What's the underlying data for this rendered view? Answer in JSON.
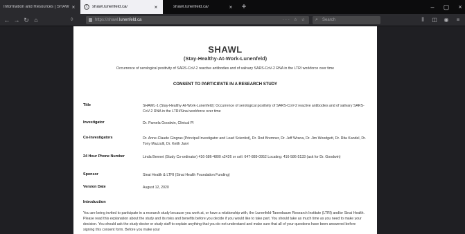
{
  "tabs": [
    {
      "title": "Information and Resources | SHAW"
    },
    {
      "title": "shawl.lunenfeld.ca/"
    },
    {
      "title": "shawl.lunenfeld.ca/"
    }
  ],
  "address_bar": {
    "prefix": "https://shawl.",
    "domain": "lunenfeld.ca",
    "actions": "··· ☆ ☆"
  },
  "search": {
    "placeholder": "Search"
  },
  "page": {
    "brand": "SHAWL",
    "brand_sub": "(Stay-Healthy-At-Work-Lunenfeld)",
    "study_line": "Occurrence of serological positivity of SARS-CoV-2 reactive antibodies and of salivary SARS-CoV-2 RNA in the LTRI workforce over time",
    "consent_heading": "CONSENT TO PARTICIPATE IN A RESEARCH STUDY",
    "rows": [
      {
        "label": "Title",
        "value": "SHAWL-1 (Stay-Healthy-At-Work-Lunenfeld): Occurrence of serological positivity of SARS-CoV-2 reactive antibodies and of salivary SARS-CoV-2 RNA in the LTRI/Sinai workforce over time"
      },
      {
        "label": "Investigator",
        "value": "Dr. Pamela Goodwin, Clinical PI"
      },
      {
        "label": "Co-Investigators",
        "value": "Dr. Anne-Claude Gingras (Principal Investigator and Lead Scientist), Dr. Rod Bremner, Dr. Jeff Wrana, Dr. Jim Woodgett, Dr. Rita Kandel, Dr. Tony Mazzulli, Dr. Keith Jarvi"
      },
      {
        "label": "24 Hour Phone Number",
        "value": "Linda Bennet (Study Co-ordinator) 416-586-4800 x2426 or cell: 647-889-0952 Locating: 416-586-5133 (ask for Dr. Goodwin)"
      },
      {
        "label": "Sponsor",
        "value": "Sinai Health & LTRI (Sinai Health Foundation Funding)"
      },
      {
        "label": "Version Date",
        "value": "August 12, 2020"
      }
    ],
    "intro_heading": "Introduction",
    "intro_text": "You are being invited to participate in a research study because you work at, or have a relationship with, the Lunenfeld-Tanenbaum Research Institute (LTRI) and/or Sinai Health. Please read this explanation about the study and its risks and benefits before you decide if you would like to take part. You should take as much time as you need to make your decision. You should ask the study doctor or study staff to explain anything that you do not understand and make sure that all of your questions have been answered before signing this consent form. Before you make your"
  }
}
